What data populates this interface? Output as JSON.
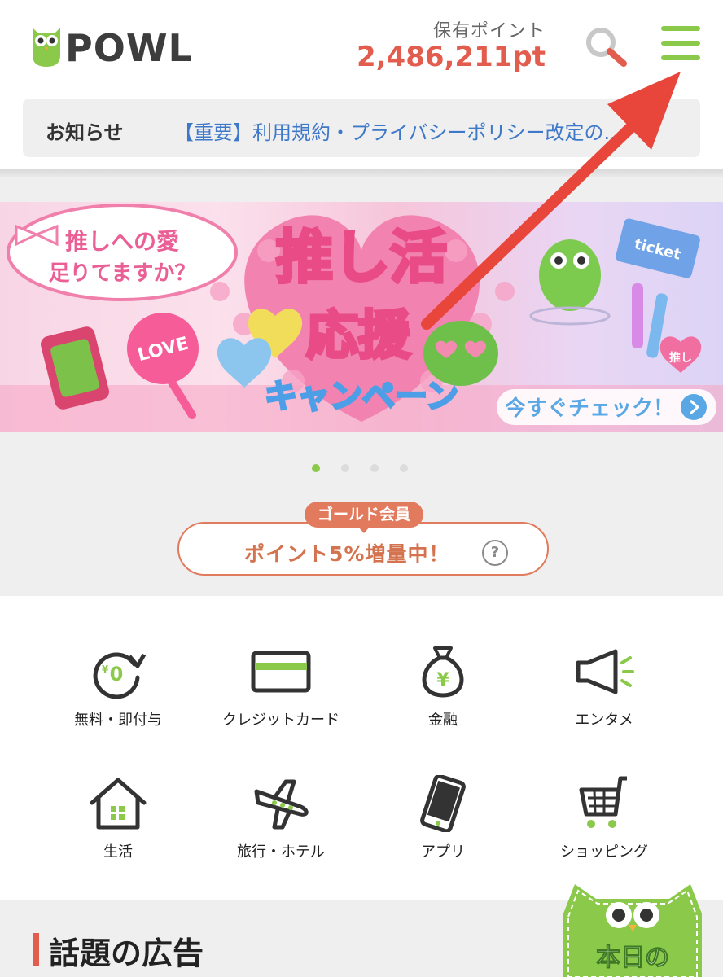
{
  "header": {
    "logo_text": "POWL",
    "points_label": "保有ポイント",
    "points_value": "2,486,211pt"
  },
  "notice": {
    "label": "お知らせ",
    "text": "【重要】利用規約・プライバシーポリシー改定の..."
  },
  "banner": {
    "bubble_line1": "推しへの愛",
    "bubble_line2": "足りてますか？",
    "title_line1": "推し活",
    "title_line2": "応援",
    "title_line3": "キャンペーン",
    "cta": "今すぐチェック！",
    "love_fan": "LOVE",
    "ticket": "ticket",
    "oshi_heart": "推し",
    "slide_count": 4,
    "active_slide": 1
  },
  "gold": {
    "badge": "ゴールド会員",
    "text": "ポイント5%増量中！",
    "help": "?"
  },
  "categories": [
    {
      "label": "無料・即付与",
      "icon": "yen-zero-icon"
    },
    {
      "label": "クレジットカード",
      "icon": "credit-card-icon"
    },
    {
      "label": "金融",
      "icon": "money-bag-icon"
    },
    {
      "label": "エンタメ",
      "icon": "megaphone-icon"
    },
    {
      "label": "生活",
      "icon": "house-icon"
    },
    {
      "label": "旅行・ホテル",
      "icon": "airplane-icon"
    },
    {
      "label": "アプリ",
      "icon": "smartphone-icon"
    },
    {
      "label": "ショッピング",
      "icon": "shopping-cart-icon"
    }
  ],
  "section": {
    "title": "話題の広告",
    "mascot_text": "本日の"
  },
  "colors": {
    "accent_green": "#8bc94a",
    "points_red": "#e35d4f",
    "notice_blue": "#3e78c8",
    "gold_orange": "#e27b5d"
  }
}
